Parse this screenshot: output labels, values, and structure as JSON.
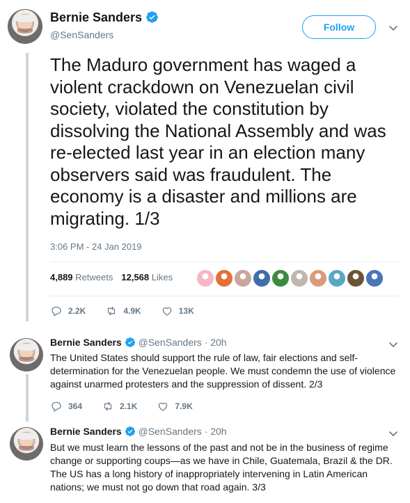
{
  "main_tweet": {
    "name": "Bernie Sanders",
    "handle": "@SenSanders",
    "follow_label": "Follow",
    "text": "The Maduro government has waged a violent crackdown on Venezuelan civil society, violated the constitution by dissolving the National Assembly and was re-elected last year in an election many observers said was fraudulent. The economy is a disaster and millions are migrating. 1/3",
    "timestamp": "3:06 PM - 24 Jan 2019",
    "retweets_count": "4,889",
    "retweets_label": "Retweets",
    "likes_count": "12,568",
    "likes_label": "Likes",
    "liker_colors": [
      "#f6b8c6",
      "#e2713a",
      "#c9a59a",
      "#3f6ea8",
      "#3d8b3d",
      "#bfb6ae",
      "#d89c7a",
      "#5aa7c4",
      "#6b5436",
      "#4a76b8"
    ],
    "replies": "2.2K",
    "retweets_short": "4.9K",
    "likes_short": "13K"
  },
  "replies": [
    {
      "name": "Bernie Sanders",
      "handle": "@SenSanders",
      "time": "· 20h",
      "text": "The United States should support the rule of law, fair elections and self-determination for the Venezuelan people. We must condemn the use of violence against unarmed protesters and the suppression of dissent. 2/3",
      "reply_count": "364",
      "retweet_count": "2.1K",
      "like_count": "7.9K"
    },
    {
      "name": "Bernie Sanders",
      "handle": "@SenSanders",
      "time": "· 20h",
      "text": "But we must learn the lessons of the past and not be in the business of regime change or supporting coups—as we have in Chile, Guatemala, Brazil & the DR. The US has a long history of inappropriately intervening in Latin American nations; we must not go down that road again. 3/3"
    }
  ],
  "colors": {
    "accent": "#1da1f2",
    "muted": "#657786",
    "text": "#14171a",
    "thread_line": "#cdd5dc"
  }
}
